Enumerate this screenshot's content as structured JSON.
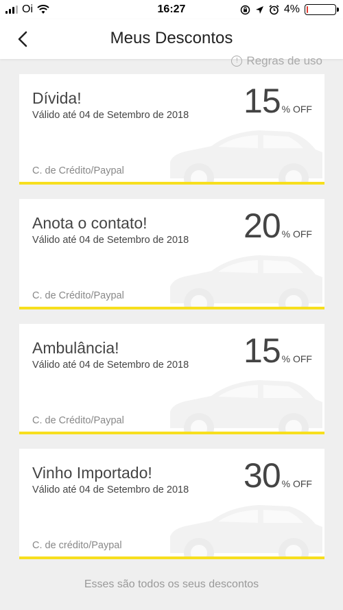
{
  "status_bar": {
    "carrier": "Oi",
    "time": "16:27",
    "battery": "4%",
    "battery_level": 0.04,
    "battery_color": "#e23a2e"
  },
  "header": {
    "title": "Meus Descontos"
  },
  "rules_link": "Regras de uso",
  "coupons": [
    {
      "title": "Dívida!",
      "valid": "Válido até 04 de Setembro de 2018",
      "value": "15",
      "off": "% OFF",
      "payment": "C. de Crédito/Paypal"
    },
    {
      "title": "Anota o contato!",
      "valid": "Válido até 04 de Setembro de 2018",
      "value": "20",
      "off": "% OFF",
      "payment": "C. de Crédito/Paypal"
    },
    {
      "title": "Ambulância!",
      "valid": "Válido até 04 de Setembro de 2018",
      "value": "15",
      "off": "% OFF",
      "payment": "C. de Crédito/Paypal"
    },
    {
      "title": "Vinho Importado!",
      "valid": "Válido até 04 de Setembro de 2018",
      "value": "30",
      "off": "% OFF",
      "payment": "C. de crédito/Paypal"
    }
  ],
  "footer_note": "Esses são todos os seus descontos",
  "colors": {
    "accent": "#f7df1e",
    "background": "#efefef",
    "card": "#ffffff",
    "text": "#444444"
  },
  "icons": {
    "back": "chevron-left-icon",
    "rules": "info-icon",
    "coupon_background": "car-icon"
  }
}
